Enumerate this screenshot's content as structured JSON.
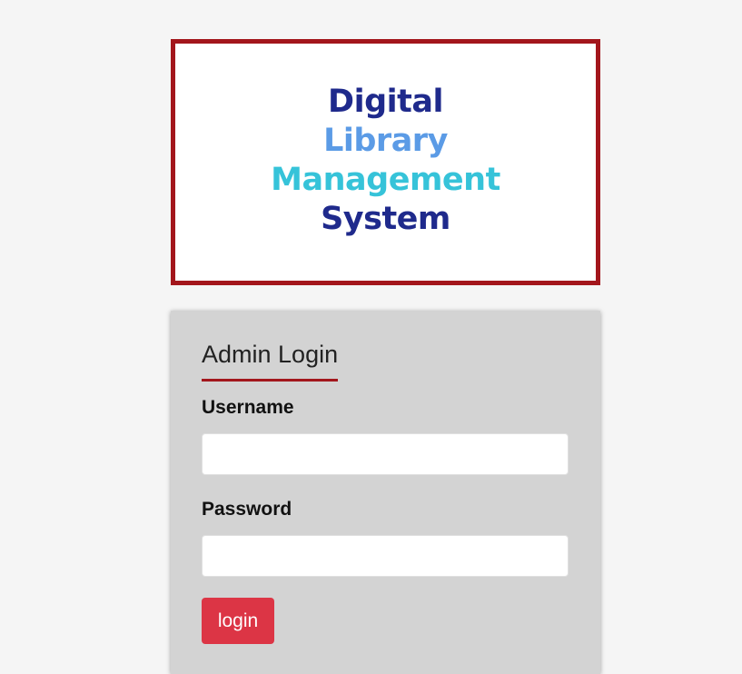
{
  "logo": {
    "line1": "Digital",
    "line2": "Library",
    "line3": "Management",
    "line4": "System"
  },
  "login": {
    "title": "Admin Login",
    "username_label": "Username",
    "username_value": "",
    "password_label": "Password",
    "password_value": "",
    "button_label": "login"
  },
  "colors": {
    "page_background": "#f5f5f5",
    "logo_border": "#a3161c",
    "logo_navy": "#1f2a8c",
    "logo_light_blue": "#5b9be6",
    "logo_cyan": "#36c3d9",
    "card_background": "#d3d3d3",
    "title_underline": "#a3161c",
    "button": "#dc3545"
  }
}
